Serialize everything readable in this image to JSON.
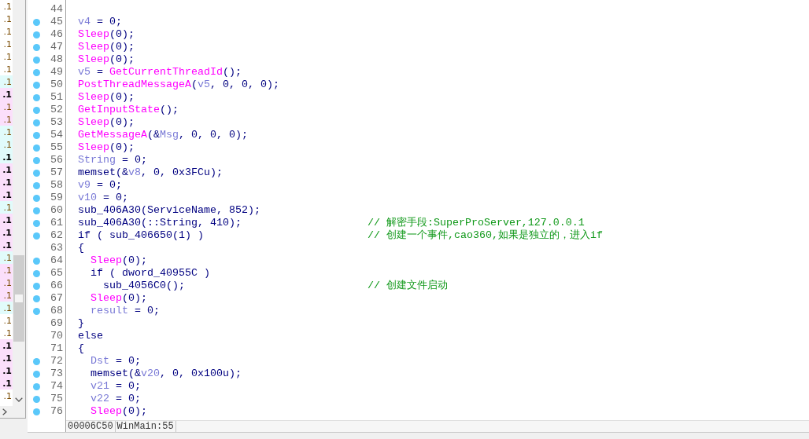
{
  "function_list": {
    "rows": [
      {
        "text": ".1",
        "color": "#ffffff",
        "bold": false
      },
      {
        "text": ".1",
        "color": "#ffffff",
        "bold": false
      },
      {
        "text": ".1",
        "color": "#ffffff",
        "bold": false
      },
      {
        "text": ".1",
        "color": "#ffffff",
        "bold": false
      },
      {
        "text": ".1",
        "color": "#ffffff",
        "bold": false
      },
      {
        "text": ".1",
        "color": "#ffffff",
        "bold": false
      },
      {
        "text": ".1",
        "color": "#e1fbfb",
        "bold": false
      },
      {
        "text": ".1",
        "color": "#fbdffb",
        "bold": true
      },
      {
        "text": ".1",
        "color": "#fbdffb",
        "bold": false
      },
      {
        "text": ".1",
        "color": "#fbdffb",
        "bold": false
      },
      {
        "text": ".1",
        "color": "#e1fbfb",
        "bold": false
      },
      {
        "text": ".1",
        "color": "#e1fbfb",
        "bold": false
      },
      {
        "text": ".1",
        "color": "#e1fbfb",
        "bold": true
      },
      {
        "text": ".1",
        "color": "#fbdffb",
        "bold": true
      },
      {
        "text": ".1",
        "color": "#fbdffb",
        "bold": true
      },
      {
        "text": ".1",
        "color": "#fbdffb",
        "bold": true
      },
      {
        "text": ".1",
        "color": "#e1fbfb",
        "bold": false
      },
      {
        "text": ".1",
        "color": "#fbdffb",
        "bold": true
      },
      {
        "text": ".1",
        "color": "#fbdffb",
        "bold": true
      },
      {
        "text": ".1",
        "color": "#fbdffb",
        "bold": true
      },
      {
        "text": ".1",
        "color": "#e1fbfb",
        "bold": false
      },
      {
        "text": ".1",
        "color": "#fbdffb",
        "bold": false
      },
      {
        "text": ".1",
        "color": "#fbdffb",
        "bold": false
      },
      {
        "text": ".1",
        "color": "#fbdffb",
        "bold": false
      },
      {
        "text": ".1",
        "color": "#e1fbfb",
        "bold": false
      },
      {
        "text": ".1",
        "color": "#ffffff",
        "bold": false
      },
      {
        "text": ".1",
        "color": "#ffffff",
        "bold": false
      },
      {
        "text": ".1",
        "color": "#fbdffb",
        "bold": true
      },
      {
        "text": ".1",
        "color": "#fbdffb",
        "bold": true
      },
      {
        "text": ".1",
        "color": "#fbdffb",
        "bold": true
      },
      {
        "text": ".1",
        "color": "#fbdffb",
        "bold": true
      },
      {
        "text": ".1",
        "color": "#ffffff",
        "bold": false
      }
    ]
  },
  "pseudocode": {
    "lines": [
      {
        "number": "44",
        "dot": false
      },
      {
        "number": "45",
        "dot": true,
        "tokens": [
          {
            "kind": "local",
            "text": "v4"
          },
          {
            "kind": "plain",
            "text": " = 0;"
          }
        ]
      },
      {
        "number": "46",
        "dot": true,
        "tokens": [
          {
            "kind": "import",
            "text": "Sleep"
          },
          {
            "kind": "plain",
            "text": "(0);"
          }
        ]
      },
      {
        "number": "47",
        "dot": true,
        "tokens": [
          {
            "kind": "import",
            "text": "Sleep"
          },
          {
            "kind": "plain",
            "text": "(0);"
          }
        ]
      },
      {
        "number": "48",
        "dot": true,
        "tokens": [
          {
            "kind": "import",
            "text": "Sleep"
          },
          {
            "kind": "plain",
            "text": "(0);"
          }
        ]
      },
      {
        "number": "49",
        "dot": true,
        "tokens": [
          {
            "kind": "local",
            "text": "v5"
          },
          {
            "kind": "plain",
            "text": " = "
          },
          {
            "kind": "import",
            "text": "GetCurrentThreadId"
          },
          {
            "kind": "plain",
            "text": "();"
          }
        ]
      },
      {
        "number": "50",
        "dot": true,
        "tokens": [
          {
            "kind": "import",
            "text": "PostThreadMessageA"
          },
          {
            "kind": "plain",
            "text": "("
          },
          {
            "kind": "local",
            "text": "v5"
          },
          {
            "kind": "plain",
            "text": ", 0, 0, 0);"
          }
        ]
      },
      {
        "number": "51",
        "dot": true,
        "tokens": [
          {
            "kind": "import",
            "text": "Sleep"
          },
          {
            "kind": "plain",
            "text": "(0);"
          }
        ]
      },
      {
        "number": "52",
        "dot": true,
        "tokens": [
          {
            "kind": "import",
            "text": "GetInputState"
          },
          {
            "kind": "plain",
            "text": "();"
          }
        ]
      },
      {
        "number": "53",
        "dot": true,
        "tokens": [
          {
            "kind": "import",
            "text": "Sleep"
          },
          {
            "kind": "plain",
            "text": "(0);"
          }
        ]
      },
      {
        "number": "54",
        "dot": true,
        "tokens": [
          {
            "kind": "import",
            "text": "GetMessageA"
          },
          {
            "kind": "plain",
            "text": "(&"
          },
          {
            "kind": "local",
            "text": "Msg"
          },
          {
            "kind": "plain",
            "text": ", 0, 0, 0);"
          }
        ]
      },
      {
        "number": "55",
        "dot": true,
        "tokens": [
          {
            "kind": "import",
            "text": "Sleep"
          },
          {
            "kind": "plain",
            "text": "(0);"
          }
        ]
      },
      {
        "number": "56",
        "dot": true,
        "tokens": [
          {
            "kind": "local",
            "text": "String"
          },
          {
            "kind": "plain",
            "text": " = 0;"
          }
        ]
      },
      {
        "number": "57",
        "dot": true,
        "tokens": [
          {
            "kind": "plain",
            "text": "memset(&"
          },
          {
            "kind": "local",
            "text": "v8"
          },
          {
            "kind": "plain",
            "text": ", 0, 0x3FCu);"
          }
        ]
      },
      {
        "number": "58",
        "dot": true,
        "tokens": [
          {
            "kind": "local",
            "text": "v9"
          },
          {
            "kind": "plain",
            "text": " = 0;"
          }
        ]
      },
      {
        "number": "59",
        "dot": true,
        "tokens": [
          {
            "kind": "local",
            "text": "v10"
          },
          {
            "kind": "plain",
            "text": " = 0;"
          }
        ]
      },
      {
        "number": "60",
        "dot": true,
        "tokens": [
          {
            "kind": "plain",
            "text": "sub_406A30(ServiceName, 852);"
          }
        ]
      },
      {
        "number": "61",
        "dot": true,
        "tokens": [
          {
            "kind": "plain",
            "text": "sub_406A30(::String, 410);"
          }
        ],
        "comment": "// 解密手段:SuperProServer,127.0.0.1"
      },
      {
        "number": "62",
        "dot": true,
        "tokens": [
          {
            "kind": "plain",
            "text": "if ( sub_406650(1) )"
          }
        ],
        "comment": "// 创建一个事件,cao360,如果是独立的，进入if"
      },
      {
        "number": "63",
        "dot": false,
        "tokens": [
          {
            "kind": "plain",
            "text": "{"
          }
        ],
        "children": [
          {
            "number": "64",
            "dot": true,
            "tokens": [
              {
                "kind": "import",
                "text": "Sleep"
              },
              {
                "kind": "plain",
                "text": "(0);"
              }
            ]
          },
          {
            "number": "65",
            "dot": true,
            "tokens": [
              {
                "kind": "plain",
                "text": "if ( dword_40955C )"
              }
            ],
            "children": [
              {
                "number": "66",
                "dot": true,
                "tokens": [
                  {
                    "kind": "plain",
                    "text": "sub_4056C0();"
                  }
                ],
                "comment": "// 创建文件启动"
              }
            ]
          },
          {
            "number": "67",
            "dot": true,
            "tokens": [
              {
                "kind": "import",
                "text": "Sleep"
              },
              {
                "kind": "plain",
                "text": "(0);"
              }
            ]
          },
          {
            "number": "68",
            "dot": true,
            "tokens": [
              {
                "kind": "local",
                "text": "result"
              },
              {
                "kind": "plain",
                "text": " = 0;"
              }
            ]
          }
        ]
      },
      {
        "number": "69",
        "dot": false,
        "tokens": [
          {
            "kind": "plain",
            "text": "}"
          }
        ]
      },
      {
        "number": "70",
        "dot": false,
        "tokens": [
          {
            "kind": "plain",
            "text": "else"
          }
        ]
      },
      {
        "number": "71",
        "dot": false,
        "tokens": [
          {
            "kind": "plain",
            "text": "{"
          }
        ],
        "children": [
          {
            "number": "72",
            "dot": true,
            "tokens": [
              {
                "kind": "local",
                "text": "Dst"
              },
              {
                "kind": "plain",
                "text": " = 0;"
              }
            ]
          },
          {
            "number": "73",
            "dot": true,
            "tokens": [
              {
                "kind": "plain",
                "text": "memset(&"
              },
              {
                "kind": "local",
                "text": "v20"
              },
              {
                "kind": "plain",
                "text": ", 0, 0x100u);"
              }
            ]
          },
          {
            "number": "74",
            "dot": true,
            "tokens": [
              {
                "kind": "local",
                "text": "v21"
              },
              {
                "kind": "plain",
                "text": " = 0;"
              }
            ]
          },
          {
            "number": "75",
            "dot": true,
            "tokens": [
              {
                "kind": "local",
                "text": "v22"
              },
              {
                "kind": "plain",
                "text": " = 0;"
              }
            ]
          },
          {
            "number": "76",
            "dot": true,
            "tokens": [
              {
                "kind": "import",
                "text": "Sleep"
              },
              {
                "kind": "plain",
                "text": "(0);"
              }
            ]
          }
        ]
      }
    ]
  },
  "status_bar": {
    "address": "00006C50",
    "location": "WinMain:55"
  }
}
